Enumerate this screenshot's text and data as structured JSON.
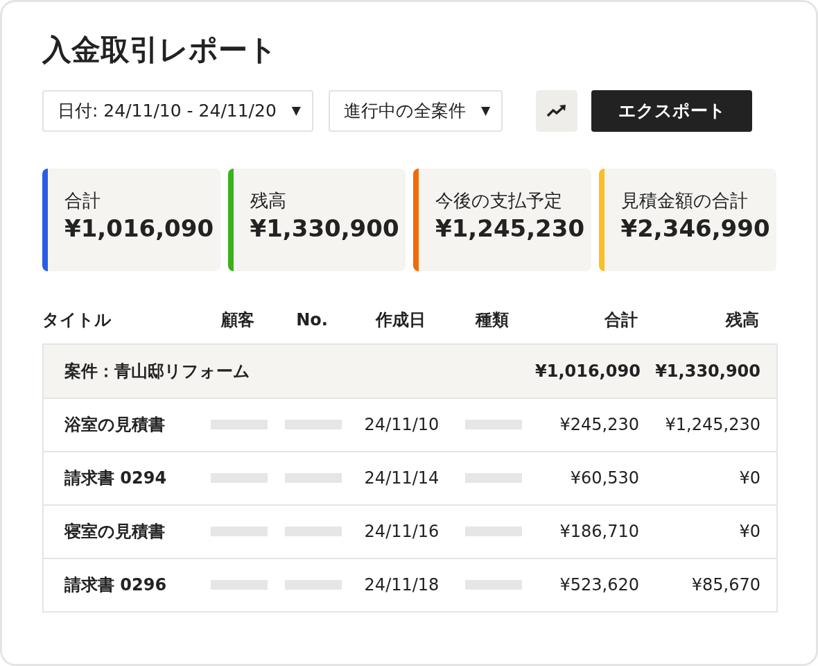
{
  "title": "入金取引レポート",
  "filters": [
    {
      "label": "日付: 24/11/10 - 24/11/20",
      "caret": "▼"
    },
    {
      "label": "進行中の全案件",
      "caret": "▼"
    }
  ],
  "export_button": "エクスポート",
  "stats": [
    {
      "label": "合計",
      "value": "¥1,016,090",
      "color": "#2b5ce6"
    },
    {
      "label": "残高",
      "value": "¥1,330,900",
      "color": "#3cb01f"
    },
    {
      "label": "今後の支払予定",
      "value": "¥1,245,230",
      "color": "#f26a0a"
    },
    {
      "label": "見積金額の合計",
      "value": "¥2,346,990",
      "color": "#fbbf24"
    }
  ],
  "table": {
    "columns": [
      "タイトル",
      "顧客",
      "No.",
      "作成日",
      "種類",
      "合計",
      "残高"
    ],
    "group": {
      "title": "案件：青山邸リフォーム",
      "total": "¥1,016,090",
      "balance": "¥1,330,900"
    },
    "rows": [
      {
        "title": "浴室の見積書",
        "date": "24/11/10",
        "total": "¥245,230",
        "balance": "¥1,245,230"
      },
      {
        "title": "請求書 0294",
        "date": "24/11/14",
        "total": "¥60,530",
        "balance": "¥0"
      },
      {
        "title": "寝室の見積書",
        "date": "24/11/16",
        "total": "¥186,710",
        "balance": "¥0"
      },
      {
        "title": "請求書 0296",
        "date": "24/11/18",
        "total": "¥523,620",
        "balance": "¥85,670"
      }
    ]
  }
}
